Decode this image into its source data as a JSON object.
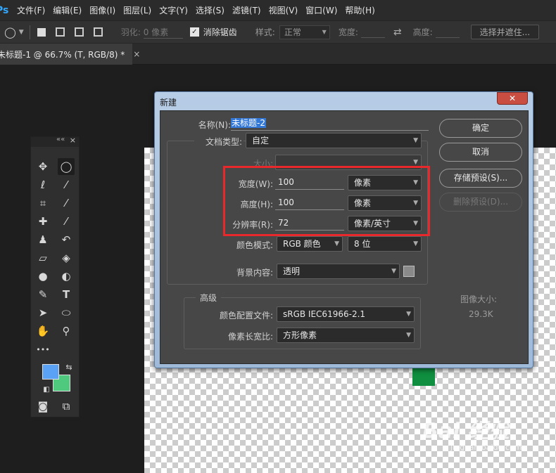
{
  "app": {
    "logo": "Ps"
  },
  "menu": [
    "文件(F)",
    "编辑(E)",
    "图像(I)",
    "图层(L)",
    "文字(Y)",
    "选择(S)",
    "滤镜(T)",
    "视图(V)",
    "窗口(W)",
    "帮助(H)"
  ],
  "options_bar": {
    "feather_label": "羽化:",
    "feather_value": "0 像素",
    "antialias_label": "消除锯齿",
    "style_label": "样式:",
    "style_value": "正常",
    "width_label": "宽度:",
    "height_label": "高度:",
    "select_mask_button": "选择并遮住..."
  },
  "document_tab": {
    "label": "未标题-1 @ 66.7% (T, RGB/8) *",
    "close": "×"
  },
  "dialog": {
    "title": "新建",
    "close": "✕",
    "name_label": "名称(N):",
    "name_value": "未标题-2",
    "preset_label": "文档类型:",
    "preset_value": "自定",
    "size_label": "大小:",
    "width_label": "宽度(W):",
    "width_value": "100",
    "width_unit": "像素",
    "height_label": "高度(H):",
    "height_value": "100",
    "height_unit": "像素",
    "resolution_label": "分辨率(R):",
    "resolution_value": "72",
    "resolution_unit": "像素/英寸",
    "color_mode_label": "颜色模式:",
    "color_mode_value": "RGB 颜色",
    "bit_depth_value": "8 位",
    "background_label": "背景内容:",
    "background_value": "透明",
    "advanced_label": "高级",
    "color_profile_label": "颜色配置文件:",
    "color_profile_value": "sRGB IEC61966-2.1",
    "pixel_aspect_label": "像素长宽比:",
    "pixel_aspect_value": "方形像素",
    "ok_button": "确定",
    "cancel_button": "取消",
    "save_preset_button": "存储预设(S)...",
    "delete_preset_button": "删除预设(D)...",
    "image_size_label": "图像大小:",
    "image_size_value": "29.3K"
  },
  "toolbox": {
    "collapse": "««",
    "close": "×",
    "more_tools": "•••"
  },
  "colors": {
    "foreground": "#5aa2f5",
    "background": "#4ec97e",
    "highlight": "#e8282b",
    "accent": "#31a8ff"
  },
  "watermark": {
    "text": "Bai 经验",
    "sub": "jingyan.baidu.com"
  }
}
